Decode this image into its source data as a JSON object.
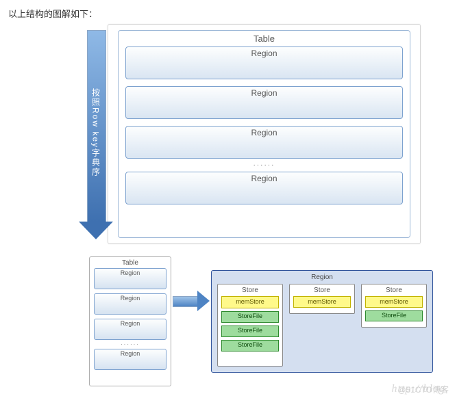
{
  "intro": "以上结构的图解如下：",
  "top": {
    "arrowLabel": "按照Row key字典序",
    "tableTitle": "Table",
    "regions": [
      "Region",
      "Region",
      "Region",
      "Region"
    ],
    "ellipsis": "······"
  },
  "bottom": {
    "miniTitle": "Table",
    "miniRegions": [
      "Region",
      "Region",
      "Region",
      "Region"
    ],
    "miniEllipsis": "······",
    "regionPanelTitle": "Region",
    "stores": [
      {
        "title": "Store",
        "mem": "memStore",
        "sf": [
          "StoreFile",
          "StoreFile",
          "StoreFile"
        ]
      },
      {
        "title": "Store",
        "mem": "memStore",
        "sf": []
      },
      {
        "title": "Store",
        "mem": "memStore",
        "sf": [
          "StoreFile"
        ]
      }
    ]
  },
  "watermark": {
    "url": "http://blog.",
    "brand": "@51CTO博客"
  }
}
